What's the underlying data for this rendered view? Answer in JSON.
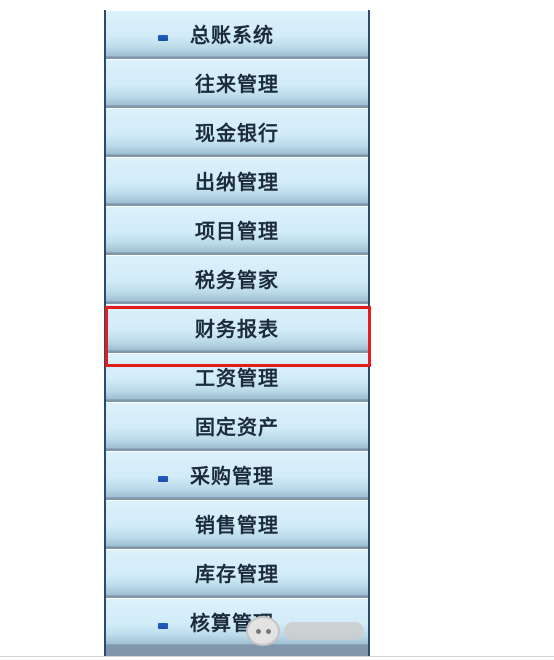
{
  "menu": {
    "items": [
      {
        "label": "总账系统",
        "group": true
      },
      {
        "label": "往来管理",
        "group": false
      },
      {
        "label": "现金银行",
        "group": false
      },
      {
        "label": "出纳管理",
        "group": false
      },
      {
        "label": "项目管理",
        "group": false
      },
      {
        "label": "税务管家",
        "group": false
      },
      {
        "label": "财务报表",
        "group": false,
        "selected": true
      },
      {
        "label": "工资管理",
        "group": false
      },
      {
        "label": "固定资产",
        "group": false
      },
      {
        "label": "采购管理",
        "group": true
      },
      {
        "label": "销售管理",
        "group": false
      },
      {
        "label": "库存管理",
        "group": false
      },
      {
        "label": "核算管理",
        "group": true
      }
    ],
    "bullet_icon": "blue-square-bullet-icon",
    "highlight_color": "#e11d1d"
  },
  "watermark": {
    "icon": "wechat-icon"
  }
}
